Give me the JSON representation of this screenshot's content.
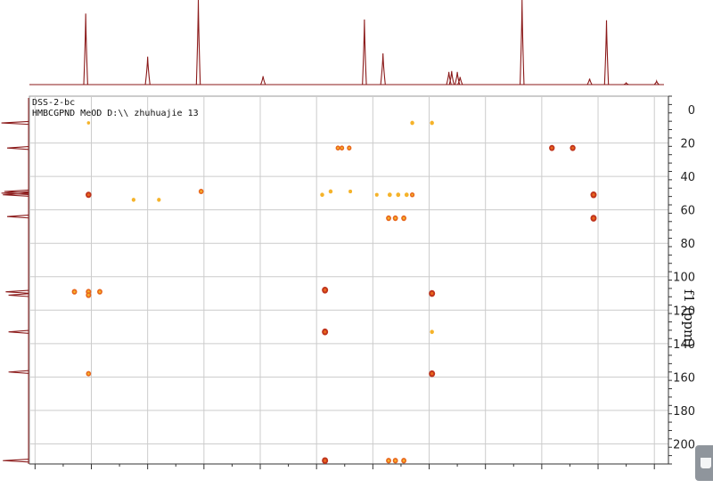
{
  "chart_data": {
    "type": "scatter",
    "title": "DSS-2-bc",
    "subtitle": "HMBCGPND MeOD D:\\\\ zhuhuajie 13",
    "xlabel": "",
    "ylabel": "f1 (ppm)",
    "y_axis_side": "right",
    "y_inverted": true,
    "ylim": [
      -8,
      212
    ],
    "yticks": [
      0,
      20,
      40,
      60,
      80,
      100,
      120,
      140,
      160,
      180,
      200
    ],
    "xlim": [
      11.1,
      -0.25
    ],
    "grid": true,
    "x_projection": {
      "name": "1H projection",
      "peaks": [
        {
          "x": 10.1,
          "height": 0.84
        },
        {
          "x": 9.0,
          "height": 0.33
        },
        {
          "x": 8.1,
          "height": 1.0
        },
        {
          "x": 6.95,
          "height": 0.1
        },
        {
          "x": 5.15,
          "height": 0.77
        },
        {
          "x": 4.82,
          "height": 0.37
        },
        {
          "x": 3.65,
          "height": 0.15
        },
        {
          "x": 3.6,
          "height": 0.16
        },
        {
          "x": 3.5,
          "height": 0.15
        },
        {
          "x": 3.45,
          "height": 0.09
        },
        {
          "x": 2.35,
          "height": 1.0
        },
        {
          "x": 1.15,
          "height": 0.07
        },
        {
          "x": 0.85,
          "height": 0.76
        },
        {
          "x": 0.5,
          "height": 0.02
        },
        {
          "x": -0.04,
          "height": 0.04
        }
      ]
    },
    "y_projection": {
      "name": "13C projection",
      "peaks": [
        {
          "y": 8,
          "height": 0.95
        },
        {
          "y": 23,
          "height": 0.75
        },
        {
          "y": 49,
          "height": 0.85
        },
        {
          "y": 50,
          "height": 0.95
        },
        {
          "y": 51,
          "height": 0.9
        },
        {
          "y": 64,
          "height": 0.75
        },
        {
          "y": 109,
          "height": 0.8
        },
        {
          "y": 111,
          "height": 0.7
        },
        {
          "y": 133,
          "height": 0.7
        },
        {
          "y": 157,
          "height": 0.7
        },
        {
          "y": 210,
          "height": 0.9
        }
      ]
    },
    "points": [
      {
        "x": 10.05,
        "y": 8,
        "intensity": 0.25
      },
      {
        "x": 4.3,
        "y": 8,
        "intensity": 0.45
      },
      {
        "x": 3.95,
        "y": 8,
        "intensity": 0.45
      },
      {
        "x": 5.62,
        "y": 23,
        "intensity": 0.6
      },
      {
        "x": 5.55,
        "y": 23,
        "intensity": 0.6
      },
      {
        "x": 5.42,
        "y": 23,
        "intensity": 0.6
      },
      {
        "x": 1.82,
        "y": 23,
        "intensity": 0.85
      },
      {
        "x": 1.45,
        "y": 23,
        "intensity": 0.85
      },
      {
        "x": 10.05,
        "y": 51,
        "intensity": 0.9
      },
      {
        "x": 8.05,
        "y": 49,
        "intensity": 0.7
      },
      {
        "x": 9.25,
        "y": 54,
        "intensity": 0.4
      },
      {
        "x": 8.8,
        "y": 54,
        "intensity": 0.4
      },
      {
        "x": 5.9,
        "y": 51,
        "intensity": 0.45
      },
      {
        "x": 5.75,
        "y": 49,
        "intensity": 0.45
      },
      {
        "x": 5.4,
        "y": 49,
        "intensity": 0.35
      },
      {
        "x": 4.93,
        "y": 51,
        "intensity": 0.35
      },
      {
        "x": 4.7,
        "y": 51,
        "intensity": 0.5
      },
      {
        "x": 4.55,
        "y": 51,
        "intensity": 0.5
      },
      {
        "x": 4.4,
        "y": 51,
        "intensity": 0.5
      },
      {
        "x": 4.3,
        "y": 51,
        "intensity": 0.6
      },
      {
        "x": 1.08,
        "y": 51,
        "intensity": 1.0
      },
      {
        "x": 4.72,
        "y": 65,
        "intensity": 0.75
      },
      {
        "x": 4.6,
        "y": 65,
        "intensity": 0.75
      },
      {
        "x": 4.45,
        "y": 65,
        "intensity": 0.75
      },
      {
        "x": 1.08,
        "y": 65,
        "intensity": 1.0
      },
      {
        "x": 10.3,
        "y": 109,
        "intensity": 0.75
      },
      {
        "x": 10.05,
        "y": 109,
        "intensity": 0.8
      },
      {
        "x": 10.05,
        "y": 111,
        "intensity": 0.8
      },
      {
        "x": 9.85,
        "y": 109,
        "intensity": 0.75
      },
      {
        "x": 5.85,
        "y": 108,
        "intensity": 1.0
      },
      {
        "x": 3.95,
        "y": 110,
        "intensity": 1.0
      },
      {
        "x": 5.85,
        "y": 133,
        "intensity": 1.0
      },
      {
        "x": 3.95,
        "y": 133,
        "intensity": 0.45
      },
      {
        "x": 10.05,
        "y": 158,
        "intensity": 0.7
      },
      {
        "x": 3.95,
        "y": 158,
        "intensity": 1.0
      },
      {
        "x": 5.85,
        "y": 210,
        "intensity": 1.0
      },
      {
        "x": 4.72,
        "y": 210,
        "intensity": 0.75
      },
      {
        "x": 4.6,
        "y": 210,
        "intensity": 0.75
      },
      {
        "x": 4.45,
        "y": 210,
        "intensity": 0.75
      }
    ]
  },
  "colors": {
    "spectrum": "#8b1a1a",
    "grid": "#cccccc",
    "axis": "#333333",
    "peak_strong": "#c0341c",
    "peak_mid": "#e8661c",
    "peak_weak": "#f5b32a"
  }
}
